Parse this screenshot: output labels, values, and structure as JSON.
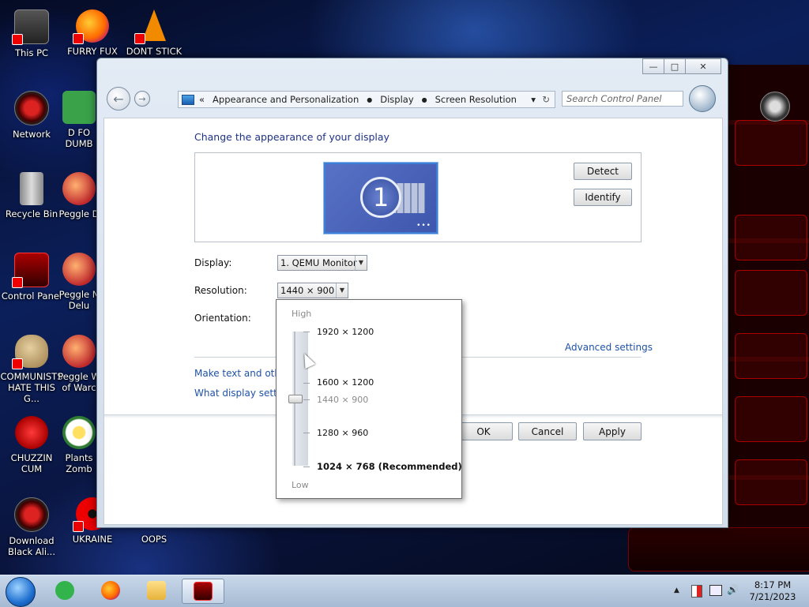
{
  "desktop_icons": [
    {
      "label": "This PC",
      "icon": "this-pc-icon"
    },
    {
      "label": "FURRY FUX",
      "icon": "firefox-icon"
    },
    {
      "label": "DONT STICK",
      "icon": "vlc-cone-icon"
    },
    {
      "label": "Network",
      "icon": "alien-network-icon"
    },
    {
      "label": "D FO DUMB",
      "icon": "green-app-icon"
    },
    {
      "label": "Recycle Bin",
      "icon": "recycle-bin-icon"
    },
    {
      "label": "Peggle D",
      "icon": "peggle-icon"
    },
    {
      "label": "Control Panel",
      "icon": "control-panel-icon"
    },
    {
      "label": "Peggle N Delu",
      "icon": "peggle-icon"
    },
    {
      "label": "COMMUNISTS HATE THIS G...",
      "icon": "money-bag-icon"
    },
    {
      "label": "Peggle W of Warc",
      "icon": "peggle-icon"
    },
    {
      "label": "CHUZZIN CUM",
      "icon": "chuzzle-icon"
    },
    {
      "label": "Plants Zomb",
      "icon": "plants-zombies-icon"
    },
    {
      "label": "Download Black Ali...",
      "icon": "alien-download-icon"
    },
    {
      "label": "UKRAINE",
      "icon": "radiation-icon"
    },
    {
      "label": "OOPS",
      "icon": "blank-icon"
    }
  ],
  "window": {
    "minimize": "—",
    "maximize": "□",
    "close": "✕",
    "address": {
      "chevron": "«",
      "crumbs": [
        "Appearance and Personalization",
        "Display",
        "Screen Resolution"
      ],
      "separator": "●",
      "dropdown": "▾",
      "refresh": "↻"
    },
    "search_placeholder": "Search Control Panel",
    "heading": "Change the appearance of your display",
    "monitor_number": "1",
    "monitor_dots": "•••",
    "detect_label": "Detect",
    "identify_label": "Identify",
    "display_label": "Display:",
    "display_value": "1. QEMU Monitor",
    "resolution_label": "Resolution:",
    "resolution_value": "1440 × 900",
    "orientation_label": "Orientation:",
    "advanced_link": "Advanced settings",
    "text_link": "Make text and other",
    "settings_link": "What display setting",
    "ok_label": "OK",
    "cancel_label": "Cancel",
    "apply_label": "Apply"
  },
  "resolution_popup": {
    "high_label": "High",
    "low_label": "Low",
    "options": [
      {
        "label": "1920 × 1200"
      },
      {
        "label": "1600 × 1200"
      },
      {
        "label": "1440 × 900"
      },
      {
        "label": "1280 × 960"
      },
      {
        "label": "1024 × 768 (Recommended)"
      }
    ]
  },
  "taskbar": {
    "tray_arrow": "▲",
    "volume": "🔊",
    "time": "8:17 PM",
    "date": "7/21/2023"
  },
  "colors": {
    "link": "#1e52a8",
    "heading": "#1e3287",
    "taskbar": "#b5c7dd"
  }
}
